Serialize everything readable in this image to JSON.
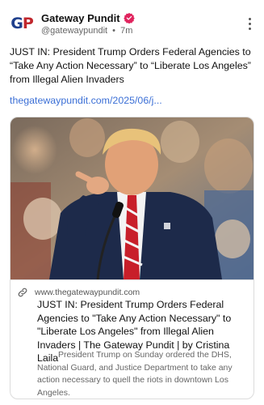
{
  "account": {
    "avatar_letters_1": "G",
    "avatar_letters_2": "P",
    "name": "Gateway Pundit",
    "handle": "@gatewaypundit",
    "separator": "•",
    "time": "7m",
    "verified_color": "#e0245e"
  },
  "post": {
    "text": "JUST IN: President Trump Orders Federal Agencies to “Take Any Action Necessary” to “Liberate Los Angeles” from Illegal Alien Invaders",
    "link": "thegatewaypundit.com/2025/06/j..."
  },
  "preview": {
    "image_description_icon": "photo-of-speaker-pointing",
    "domain": "www.thegatewaypundit.com",
    "title": "JUST IN: President Trump Orders Federal Agencies to \"Take Any Action Necessary\" to \"Liberate Los Angeles\" from Illegal Alien Invaders | The Gateway Pundit | by Cristina Laila",
    "description": "President Trump on Sunday ordered the DHS, National Guard, and Justice Department to take any action necessary to quell the riots in downtown Los Angeles."
  },
  "colors": {
    "link": "#3b6fd6",
    "brand_blue": "#1f3f8c",
    "brand_red": "#c0272d"
  }
}
